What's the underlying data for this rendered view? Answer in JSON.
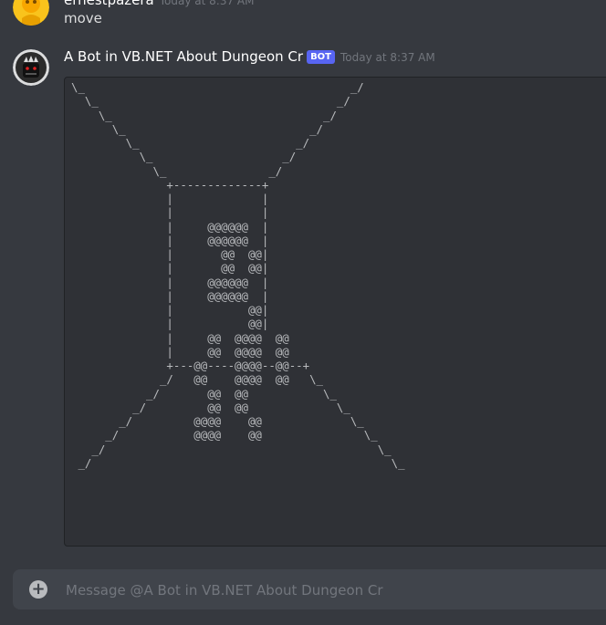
{
  "messages": [
    {
      "author": "ernestpazera",
      "timestamp": "Today at 8:37 AM",
      "text": "move"
    },
    {
      "author": "A Bot in VB.NET About Dungeon Cr",
      "bot_tag": "BOT",
      "timestamp": "Today at 8:37 AM",
      "code": "\\_                                       _/\n  \\_                                   _/\n    \\_                               _/\n      \\_                           _/\n        \\_                       _/\n          \\_                   _/\n            \\_               _/\n              +-------------+\n              |             |\n              |             |\n              |     @@@@@@  |\n              |     @@@@@@  |\n              |       @@  @@|\n              |       @@  @@|\n              |     @@@@@@  |\n              |     @@@@@@  |\n              |           @@|\n              |           @@|\n              |     @@  @@@@  @@\n              |     @@  @@@@  @@\n              +---@@----@@@@--@@--+\n             _/   @@    @@@@  @@   \\_\n           _/       @@  @@           \\_\n         _/         @@  @@             \\_\n       _/         @@@@    @@             \\_\n     _/           @@@@    @@               \\_\n   _/                                        \\_\n _/                                            \\_"
    }
  ],
  "composer": {
    "placeholder": "Message @A Bot in VB.NET About Dungeon Cr",
    "add_label": "+"
  },
  "colors": {
    "background": "#36393f",
    "codeblock_bg": "#2f3136",
    "bot_tag": "#5865f2"
  }
}
